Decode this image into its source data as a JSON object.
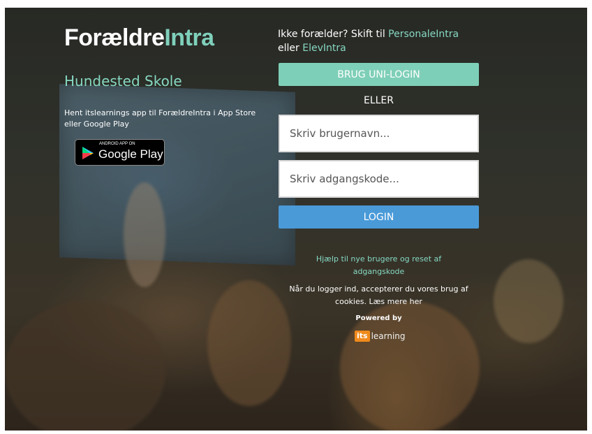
{
  "brand": {
    "name_part1": "Forældre",
    "name_part2": "Intra",
    "accent_color": "#7fd0bb"
  },
  "school_name": "Hundested Skole",
  "app_promo": {
    "text": "Hent itslearnings app til ForældreIntra i App Store eller Google Play",
    "badge_small": "ANDROID APP ON",
    "badge_big": "Google Play"
  },
  "switch": {
    "prefix": "Ikke forælder? Skift til ",
    "link1": "PersonaleIntra",
    "middle": "eller ",
    "link2": "ElevIntra"
  },
  "uni_login_button": "BRUG UNI-LOGIN",
  "or_text": "ELLER",
  "username": {
    "placeholder": "Skriv brugernavn...",
    "value": ""
  },
  "password": {
    "placeholder": "Skriv adgangskode...",
    "value": ""
  },
  "login_button": "LOGIN",
  "help_link": "Hjælp til nye brugere og reset af adgangskode",
  "cookies": {
    "text": "Når du logger ind, accepterer du vores brug af cookies. ",
    "link": "Læs mere her"
  },
  "powered_by": "Powered by",
  "provider": {
    "its": "its",
    "learning": "learning"
  },
  "colors": {
    "uni_button": "#7ecfb7",
    "login_button": "#4a9ad8",
    "provider_orange": "#f08a1c"
  }
}
